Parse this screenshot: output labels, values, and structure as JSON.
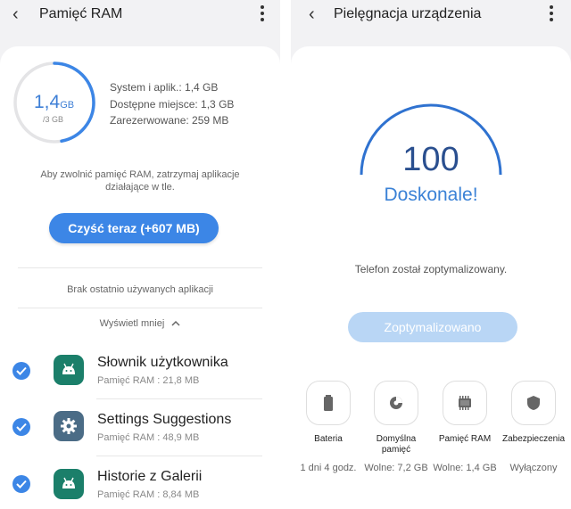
{
  "left": {
    "title": "Pamięć RAM",
    "ram_used_value": "1,4",
    "ram_used_unit": "GB",
    "ram_total": "/3 GB",
    "ram_used_fraction": 0.47,
    "stats": [
      "System i aplik.: 1,4 GB",
      "Dostępne miejsce: 1,3 GB",
      "Zarezerwowane: 259 MB"
    ],
    "hint": "Aby zwolnić pamięć RAM, zatrzymaj aplikacje działające w tle.",
    "clean_button": "Czyść teraz (+607 MB)",
    "no_recent": "Brak ostatnio używanych aplikacji",
    "show_less": "Wyświetl mniej",
    "apps": [
      {
        "name": "Słownik użytkownika",
        "memory": "Pamięć RAM : 21,8 MB",
        "icon": "android-icon",
        "checked": true
      },
      {
        "name": "Settings Suggestions",
        "memory": "Pamięć RAM : 48,9 MB",
        "icon": "gear-icon",
        "checked": true
      },
      {
        "name": "Historie z Galerii",
        "memory": "Pamięć RAM : 8,84 MB",
        "icon": "android-icon",
        "checked": true
      }
    ]
  },
  "right": {
    "title": "Pielęgnacja urządzenia",
    "score": "100",
    "grade": "Doskonale!",
    "status_text": "Telefon został zoptymalizowany.",
    "optimized_button": "Zoptymalizowano",
    "tiles": [
      {
        "label": "Bateria",
        "value": "1 dni 4 godz.",
        "icon": "battery-icon"
      },
      {
        "label": "Domyślna pamięć",
        "value": "Wolne: 7,2 GB",
        "icon": "storage-pie-icon"
      },
      {
        "label": "Pamięć RAM",
        "value": "Wolne: 1,4 GB",
        "icon": "memory-chip-icon"
      },
      {
        "label": "Zabezpieczenia",
        "value": "Wyłączony",
        "icon": "shield-icon"
      }
    ]
  },
  "colors": {
    "accent": "#3c86e6",
    "accent_light": "#b9d6f5",
    "score_text": "#2a4f8f",
    "background": "#f2f2f4",
    "card": "#ffffff",
    "android_icon_bg": "#1b7f6a",
    "gear_icon_bg": "#4b6c86"
  }
}
